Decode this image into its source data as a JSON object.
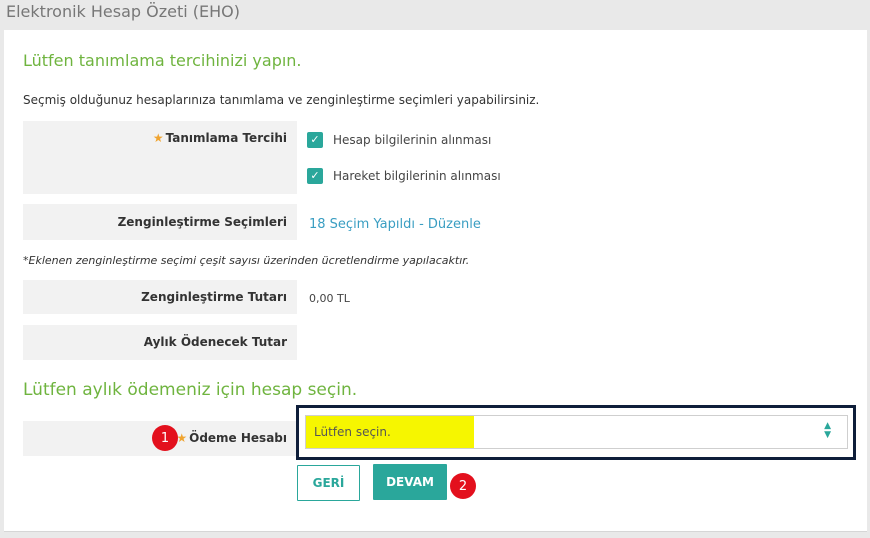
{
  "page": {
    "title": "Elektronik Hesap Özeti (EHO)"
  },
  "section1": {
    "heading": "Lütfen tanımlama tercihinizi yapın.",
    "intro": "Seçmiş olduğunuz hesaplarınıza tanımlama ve zenginleştirme seçimleri yapabilirsiniz.",
    "preference": {
      "star": "★",
      "label": "Tanımlama Tercihi",
      "options": [
        {
          "label": "Hesap bilgilerinin alınması",
          "checked": true
        },
        {
          "label": "Hareket bilgilerinin alınması",
          "checked": true
        }
      ],
      "check_glyph": "✓"
    },
    "enrichment": {
      "label": "Zenginleştirme Seçimleri",
      "link": "18 Seçim Yapıldı - Düzenle"
    },
    "note": "*Eklenen zenginleştirme seçimi çeşit sayısı üzerinden ücretlendirme yapılacaktır.",
    "enrichment_amount": {
      "label": "Zenginleştirme Tutarı",
      "value": "0,00 TL"
    },
    "monthly_amount": {
      "label": "Aylık Ödenecek Tutar",
      "value": ""
    }
  },
  "section2": {
    "heading": "Lütfen aylık ödemeniz için hesap seçin.",
    "payment_account": {
      "star": "★",
      "label": "Ödeme Hesabı",
      "placeholder": "Lütfen seçin.",
      "arrow_up": "▲",
      "arrow_down": "▼"
    }
  },
  "annotations": {
    "badge1": "1",
    "badge2": "2"
  },
  "buttons": {
    "back": "GERİ",
    "next": "DEVAM"
  },
  "colors": {
    "accent": "#2aa79b",
    "heading_green": "#6fb43f",
    "link_blue": "#3a9ec2",
    "star_orange": "#f0a430",
    "badge_red": "#e3101d",
    "highlight_yellow": "#f6f600",
    "outline_navy": "#0f1e3a"
  },
  "icons": {
    "checkbox": "checkbox-checked-icon",
    "star": "required-star-icon",
    "select_arrows": "sort-arrows-icon"
  }
}
